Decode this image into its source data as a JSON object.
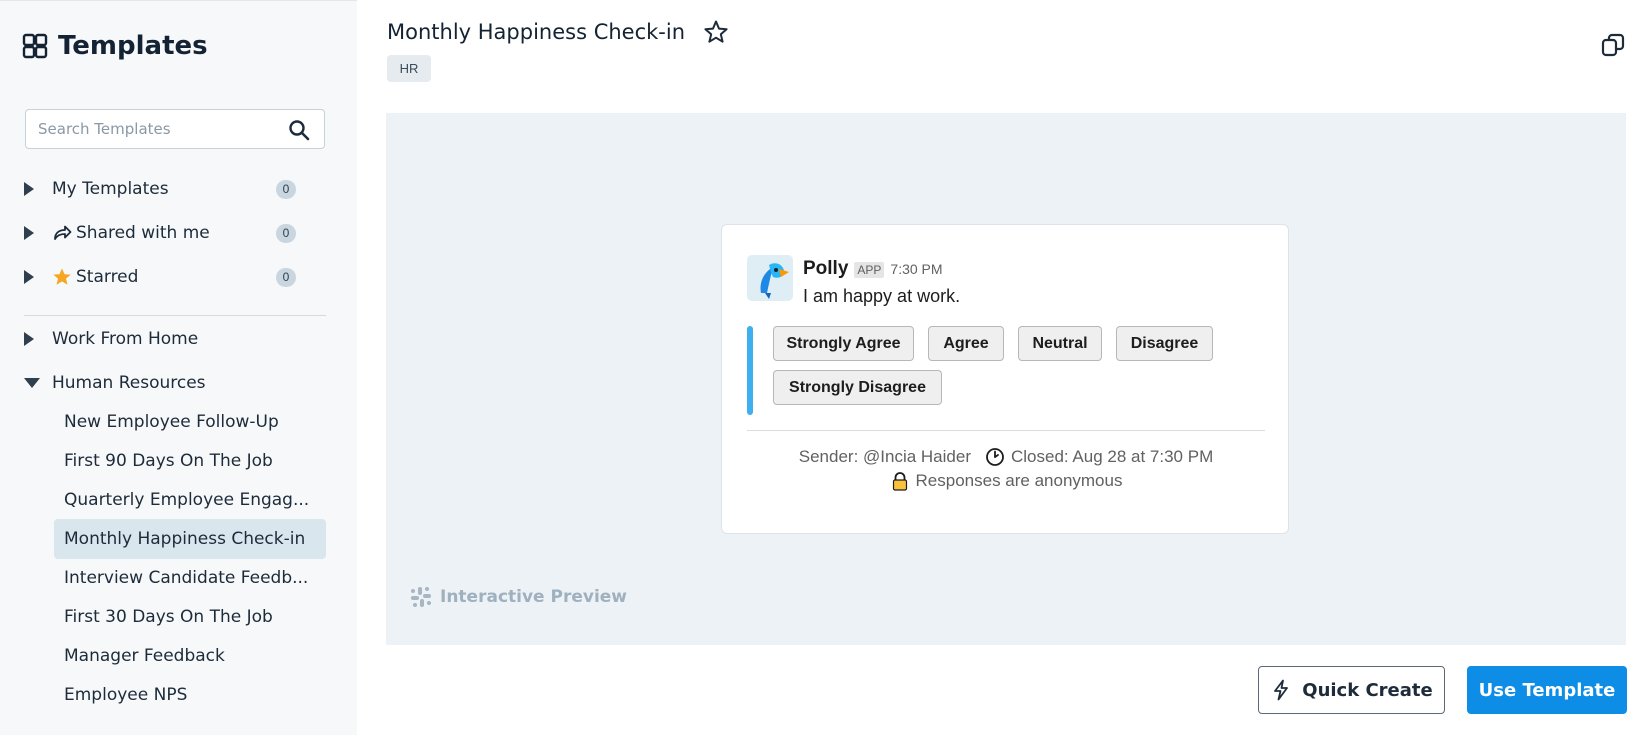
{
  "sidebar": {
    "brand_title": "Templates",
    "search_placeholder": "Search Templates",
    "sections": [
      {
        "label": "My Templates",
        "count": "0"
      },
      {
        "label": "Shared with me",
        "count": "0"
      },
      {
        "label": "Starred",
        "count": "0"
      }
    ],
    "categories": [
      {
        "label": "Work From Home"
      },
      {
        "label": "Human Resources"
      }
    ],
    "hr_items": [
      "New Employee Follow-Up",
      "First 90 Days On The Job",
      "Quarterly Employee Engag...",
      "Monthly Happiness Check-in",
      "Interview Candidate Feedb...",
      "First 30 Days On The Job",
      "Manager Feedback",
      "Employee NPS"
    ],
    "active_item": "Monthly Happiness Check-in"
  },
  "main": {
    "title": "Monthly Happiness Check-in",
    "tag": "HR",
    "preview_label": "Interactive Preview"
  },
  "message": {
    "sender_name": "Polly",
    "app_badge": "APP",
    "time": "7:30 PM",
    "question": "I am happy at work.",
    "options": [
      "Strongly Agree",
      "Agree",
      "Neutral",
      "Disagree",
      "Strongly Disagree"
    ],
    "sender_line": "Sender: @Incia Haider",
    "closed_line": "Closed: Aug 28 at 7:30 PM",
    "anonymous_line": "Responses are anonymous"
  },
  "actions": {
    "quick_create": "Quick Create",
    "use_template": "Use Template"
  },
  "colors": {
    "primary": "#0d8de6",
    "accent_bar": "#3eb0f0",
    "star": "#f5a623",
    "active_item_bg": "#dae6ee"
  }
}
